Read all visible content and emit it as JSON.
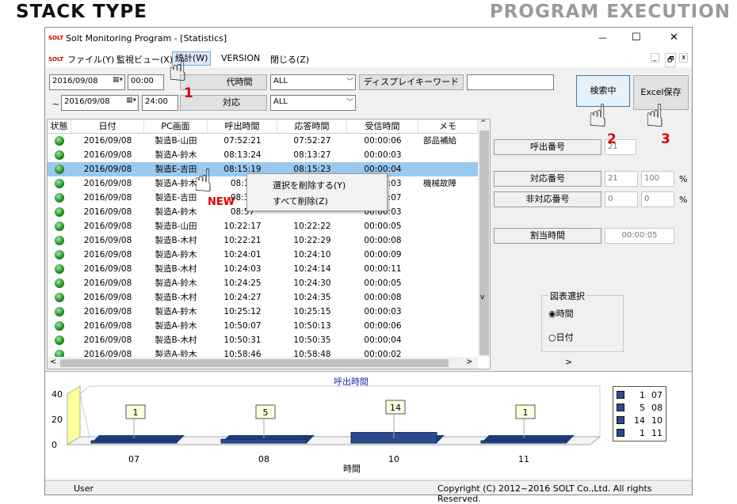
{
  "banner": {
    "left": "STACK TYPE",
    "right": "PROGRAM EXECUTION"
  },
  "window": {
    "logo": "SOLT",
    "title": "Solt Monitoring Program - [Statistics]",
    "min": "—",
    "max": "☐",
    "close": "✕"
  },
  "menu": {
    "logo": "SOLT",
    "items": [
      "ファイル(Y)",
      "監視ビュー(X)",
      "統計(W)",
      "VERSION",
      "閉じる(Z)"
    ],
    "mdi": [
      "_",
      "🗗",
      "x"
    ]
  },
  "filters": {
    "date_from": "2016/09/08",
    "time_from": "00:00",
    "date_to": "2016/09/08",
    "time_to": "24:00",
    "tilde": "~",
    "btn_time": "時間",
    "btn_time_full": "代時間",
    "btn_corr": "対応",
    "combo1": "ALL",
    "combo2": "ALL",
    "keyword_label": "ディスプレイキーワード",
    "keyword_value": "",
    "search_label": "検索中",
    "excel_label": "Excel保存"
  },
  "grid": {
    "headers": [
      "状態",
      "日付",
      "PC画面",
      "呼出時間",
      "応答時間",
      "受信時間",
      "メモ"
    ],
    "rows": [
      [
        "2016/09/08",
        "製造B-山田",
        "07:52:21",
        "07:52:27",
        "00:00:06",
        "部品補給"
      ],
      [
        "2016/09/08",
        "製造A-鈴木",
        "08:13:24",
        "08:13:27",
        "00:00:03",
        ""
      ],
      [
        "2016/09/08",
        "製造E-吉田",
        "08:15:19",
        "08:15:23",
        "00:00:04",
        ""
      ],
      [
        "2016/09/08",
        "製造A-鈴木",
        "08:16",
        "",
        "00:00:03",
        "機械故障"
      ],
      [
        "2016/09/08",
        "製造E-吉田",
        "08:36",
        "",
        "00:00:07",
        ""
      ],
      [
        "2016/09/08",
        "製造A-鈴木",
        "08:57",
        "",
        "00:00:03",
        ""
      ],
      [
        "2016/09/08",
        "製造B-山田",
        "10:22:17",
        "10:22:22",
        "00:00:05",
        ""
      ],
      [
        "2016/09/08",
        "製造B-木村",
        "10:22:21",
        "10:22:29",
        "00:00:08",
        ""
      ],
      [
        "2016/09/08",
        "製造A-鈴木",
        "10:24:01",
        "10:24:10",
        "00:00:09",
        ""
      ],
      [
        "2016/09/08",
        "製造B-木村",
        "10:24:03",
        "10:24:14",
        "00:00:11",
        ""
      ],
      [
        "2016/09/08",
        "製造A-鈴木",
        "10:24:25",
        "10:24:30",
        "00:00:05",
        ""
      ],
      [
        "2016/09/08",
        "製造B-木村",
        "10:24:27",
        "10:24:35",
        "00:00:08",
        ""
      ],
      [
        "2016/09/08",
        "製造A-鈴木",
        "10:25:12",
        "10:25:15",
        "00:00:03",
        ""
      ],
      [
        "2016/09/08",
        "製造A-鈴木",
        "10:50:07",
        "10:50:13",
        "00:00:06",
        ""
      ],
      [
        "2016/09/08",
        "製造B-木村",
        "10:50:31",
        "10:50:35",
        "00:00:04",
        ""
      ],
      [
        "2016/09/08",
        "製造A-鈴木",
        "10:58:46",
        "10:58:48",
        "00:00:02",
        ""
      ]
    ],
    "selected_index": 2,
    "scroll_left": "<",
    "scroll_right": ">",
    "scroll_up": "^",
    "scroll_down": "v"
  },
  "context_menu": {
    "items": [
      "選択を削除する(Y)",
      "すべて削除(Z)"
    ]
  },
  "right_panel": {
    "call_no_label": "呼出番号",
    "call_no_value": "21",
    "corr_no_label": "対応番号",
    "corr_no_value": "21",
    "corr_pct": "100",
    "noncorr_label": "非対応番号",
    "noncorr_value": "0",
    "noncorr_pct": "0",
    "pct": "%",
    "assign_label": "割当時間",
    "assign_value": "00:00:05",
    "chart_select_label": "図表選択",
    "opt_time": "時間",
    "opt_date": "日付",
    "scroll_right": ">"
  },
  "chart_data": {
    "type": "bar",
    "title": "呼出時間",
    "xlabel": "時間",
    "ylabel": "",
    "categories": [
      "07",
      "08",
      "10",
      "11"
    ],
    "values": [
      1,
      5,
      14,
      1
    ],
    "ylim": [
      0,
      40
    ],
    "yticks": [
      "40",
      "20",
      "0"
    ],
    "legend": [
      [
        "1",
        "07"
      ],
      [
        "5",
        "08"
      ],
      [
        "14",
        "10"
      ],
      [
        "1",
        "11"
      ]
    ],
    "bar_color": "#2b4a8f",
    "legend_placement": "right"
  },
  "status": {
    "user": "User",
    "copyright": "Copyright (C) 2012~2016 SOLT Co.,Ltd. All rights Reserved."
  },
  "callouts": {
    "n1": "1",
    "n2": "2",
    "n3": "3",
    "new": "NEW"
  }
}
